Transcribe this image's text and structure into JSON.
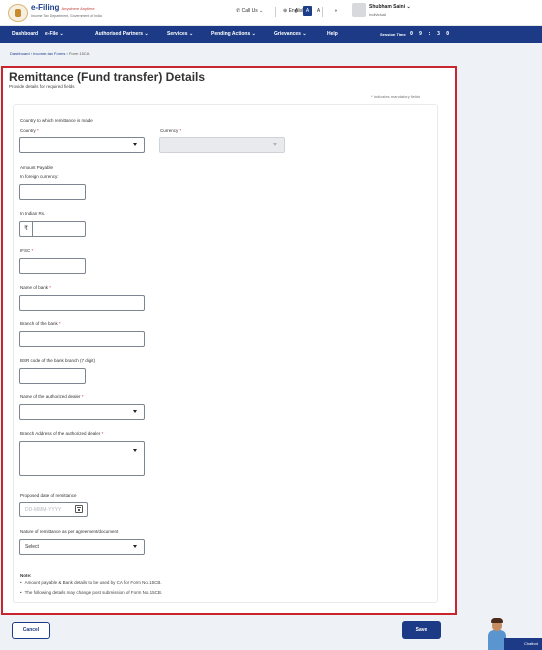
{
  "header": {
    "logo_title": "e-Filing",
    "logo_subtitle": "Anywhere Anytime",
    "logo_tagline": "Income Tax Department, Government of India",
    "call_us": "Call Us",
    "language": "English",
    "font_small": "A",
    "font_normal": "A",
    "font_large": "A",
    "user_name": "Shubham Saini",
    "user_role": "Individual"
  },
  "nav": {
    "items": [
      "Dashboard",
      "e-File",
      "Authorised Partners",
      "Services",
      "Pending Actions",
      "Grievances",
      "Help"
    ],
    "session_label": "Session Time",
    "session_time": "0 9 : 3 0"
  },
  "breadcrumb": [
    "Dashboard",
    "Income-tax Forms",
    "Form 15CA"
  ],
  "page": {
    "title": "Remittance (Fund transfer) Details",
    "subtitle": "Provide details for required fields",
    "mandatory_note": "* Indicates mandatory fields"
  },
  "form": {
    "country_section": "Country to which remittance is made",
    "country_label": "Country",
    "country_value": "",
    "currency_label": "Currency",
    "currency_value": "",
    "amount_section": "Amount Payable",
    "foreign_label": "In foreign currency:",
    "foreign_value": "",
    "indian_label": "In Indian Rs.",
    "rupee_symbol": "₹",
    "indian_value": "",
    "ifsc_label": "IFSC",
    "ifsc_value": "",
    "bank_name_label": "Name of bank",
    "bank_name_value": "",
    "branch_label": "Branch of the bank",
    "branch_value": "",
    "bsr_label": "BSR code of the bank branch (7 digit)",
    "bsr_value": "",
    "dealer_label": "Name of the authorized dealer",
    "dealer_value": "",
    "dealer_address_label": "Branch Address of the authorized dealer",
    "dealer_address_value": "",
    "date_label": "Proposed date of remittance",
    "date_placeholder": "DD-MMM-YYYY",
    "nature_label": "Nature of remittance as per agreement/document",
    "nature_value": "Select",
    "required_mark": "*"
  },
  "notes": {
    "title": "Note:",
    "items": [
      "Amount payable & Bank details to be used by CA for Form No.15CB.",
      "The following details may change post submission of Form No.15CB."
    ]
  },
  "footer": {
    "cancel_label": "Cancel",
    "save_label": "Save",
    "chatbot_label": "Chatbot"
  },
  "colors": {
    "brand": "#1c3a85",
    "highlight_frame": "#c8252c",
    "required": "#d0312d"
  }
}
